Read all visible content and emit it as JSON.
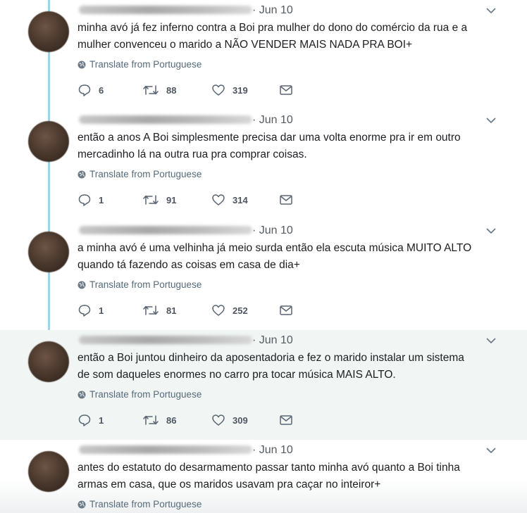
{
  "tweets": [
    {
      "date": "· Jun 10",
      "text": "minha avó já fez inferno contra a Boi pra mulher do dono do comércio da rua e a\nmulher convenceu o marido a NÃO VENDER MAIS NADA PRA BOI+",
      "translate": "Translate from Portuguese",
      "replies": "6",
      "retweets": "88",
      "likes": "319"
    },
    {
      "date": "· Jun 10",
      "text": "então a anos A Boi simplesmente precisa dar uma volta enorme pra ir em outro\nmercadinho lá na outra rua pra comprar coisas.",
      "translate": "Translate from Portuguese",
      "replies": "1",
      "retweets": "91",
      "likes": "314"
    },
    {
      "date": "· Jun 10",
      "text": "a minha avó é uma velhinha já meio surda então ela escuta música MUITO ALTO\nquando tá fazendo as coisas em casa de dia+",
      "translate": "Translate from Portuguese",
      "replies": "1",
      "retweets": "81",
      "likes": "252"
    },
    {
      "date": "· Jun 10",
      "text": "então a Boi juntou dinheiro da aposentadoria e fez o marido instalar um sistema\nde som daqueles enormes no carro pra tocar música MAIS ALTO.",
      "translate": "Translate from Portuguese",
      "replies": "1",
      "retweets": "86",
      "likes": "309"
    },
    {
      "date": "· Jun 10",
      "text": "antes do estatuto do desarmamento passar tanto minha avó quanto a Boi tinha\narmas em casa, que os maridos usavam pra caçar no inteiror+",
      "translate": "Translate from Portuguese"
    }
  ],
  "icons": {
    "globe": "globe-icon",
    "reply": "reply-icon",
    "retweet": "retweet-icon",
    "like": "heart-icon",
    "dm": "envelope-icon",
    "caret": "chevron-down-icon"
  },
  "colors": {
    "thread_line": "#9fd4ec",
    "highlight_bg": "#f1f6f4",
    "muted_text": "#555c63"
  }
}
